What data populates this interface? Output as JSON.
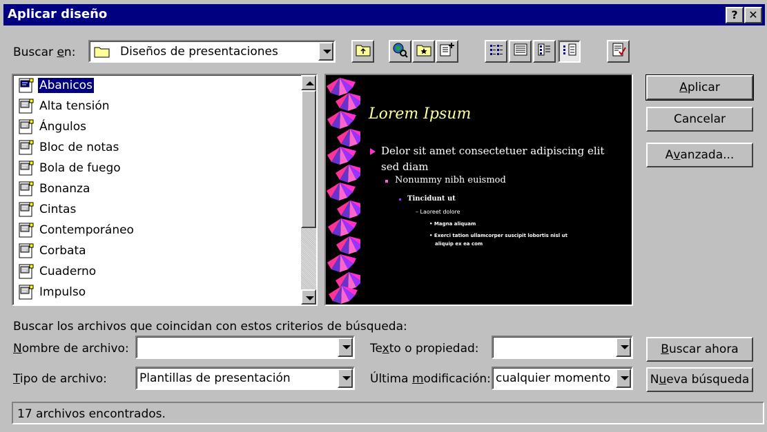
{
  "window": {
    "title": "Aplicar diseño",
    "help_btn": "?",
    "close_btn": "✕"
  },
  "lookin": {
    "label_pre": "Buscar ",
    "label_u": "e",
    "label_post": "n:",
    "value": "Diseños de presentaciones"
  },
  "files": [
    "Abanicos",
    "Alta tensión",
    "Ángulos",
    "Bloc de notas",
    "Bola de fuego",
    "Bonanza",
    "Cintas",
    "Contemporáneo",
    "Corbata",
    "Cuaderno",
    "Impulso"
  ],
  "selected_file": "Abanicos",
  "preview": {
    "title": "Lorem Ipsum",
    "bullet1_line1": "Delor sit amet consectetuer adipiscing elit",
    "bullet1_line2": "sed diam",
    "bullet2": "Nonummy nibh euismod",
    "bullet3": "Tincidunt ut",
    "bullet4": "Laoreet dolore",
    "bullet5": "Magna aliquam",
    "bullet6_line1": "Exerci tation ullamcorper suscipit lobortis nisl ut",
    "bullet6_line2": "aliquip ex ea com"
  },
  "buttons": {
    "apply_u": "A",
    "apply_rest": "plicar",
    "cancel": "Cancelar",
    "advanced_pre": "A",
    "advanced_u": "v",
    "advanced_post": "anzada...",
    "find_now_u": "B",
    "find_now_rest": "uscar ahora",
    "new_search_pre": "N",
    "new_search_u": "u",
    "new_search_post": "eva búsqueda"
  },
  "search": {
    "criteria_label": "Buscar los archivos que coincidan con estos criterios de búsqueda:",
    "filename_u": "N",
    "filename_rest": "ombre de archivo:",
    "filename_value": "",
    "filetype_u": "T",
    "filetype_rest": "ipo de archivo:",
    "filetype_value": "Plantillas de presentación",
    "text_pre": "Te",
    "text_u": "x",
    "text_post": "to o propiedad:",
    "text_value": "",
    "modified_pre": "Última ",
    "modified_u": "m",
    "modified_post": "odificación:",
    "modified_value": "cualquier momento"
  },
  "status": {
    "text": "17 archivos encontrados."
  },
  "colors": {
    "titlebar": "#000080",
    "face": "#c0c0c0",
    "selection": "#000080",
    "preview_bg": "#000000",
    "preview_title": "#ffff99"
  },
  "icons": [
    "folder-icon",
    "up-folder-icon",
    "web-search-icon",
    "favorites-icon",
    "add-favorites-icon",
    "list-view-icon",
    "details-view-icon",
    "properties-view-icon",
    "preview-view-icon",
    "commands-icon"
  ]
}
